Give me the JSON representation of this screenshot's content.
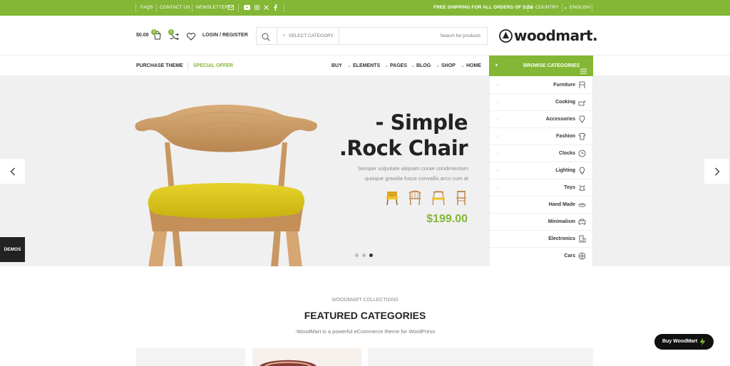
{
  "topbar": {
    "faqs": "FAQS",
    "contact": "CONTACT US",
    "newsletter": "NEWSLETTER",
    "shipping": "FREE SHIPPING FOR ALL ORDERS OF $150",
    "country": "COUNTRY",
    "language": "ENGLISH",
    "social": [
      "youtube-icon",
      "instagram-icon",
      "x-icon",
      "facebook-icon"
    ]
  },
  "header": {
    "cart_total": "$0.00",
    "cart_count": "0",
    "compare_count": "0",
    "login": "LOGIN / REGISTER",
    "search_category": "SELECT CATEGORY",
    "search_placeholder": "Search for products",
    "logo": "woodmart."
  },
  "nav": {
    "purchase": "PURCHASE THEME",
    "special": "SPECIAL OFFER",
    "items": [
      "BUY",
      "ELEMENTS",
      "PAGES",
      "BLOG",
      "SHOP",
      "HOME"
    ],
    "browse": "BROWSE CATEGORIES"
  },
  "hero": {
    "title_line1": "- Simple",
    "title_line2": ".Rock Chair",
    "sub_line1": "Semper vulputate aliquam curae condimentum",
    "sub_line2": ".quisque gravida fusce convallis arcu cum at",
    "price": "$199.00",
    "active_slide": 3,
    "demos": "DEMOS"
  },
  "categories": [
    {
      "label": "Furniture",
      "icon": "chair-icon"
    },
    {
      "label": "Cooking",
      "icon": "cooking-icon"
    },
    {
      "label": "Accessories",
      "icon": "accessories-icon"
    },
    {
      "label": "Fashion",
      "icon": "shirt-icon"
    },
    {
      "label": "Clocks",
      "icon": "clock-icon"
    },
    {
      "label": "Lighting",
      "icon": "bulb-icon"
    },
    {
      "label": "Toys",
      "icon": "rocking-horse-icon"
    },
    {
      "label": "Hand Made",
      "icon": "handmade-icon"
    },
    {
      "label": "Minimalism",
      "icon": "minimalism-icon"
    },
    {
      "label": "Electronics",
      "icon": "electronics-icon"
    },
    {
      "label": "Cars",
      "icon": "wheel-icon"
    }
  ],
  "featured": {
    "eyebrow": "WOODMART COLLECTIONS",
    "title": "FEATURED CATEGORIES",
    "desc": ".WoodMart is a powerful eCommerce theme for WordPress"
  },
  "buy_button": "Buy WoodMart",
  "colors": {
    "accent": "#83b735",
    "dark": "#222222",
    "hero_bg": "#f0f0f0"
  }
}
